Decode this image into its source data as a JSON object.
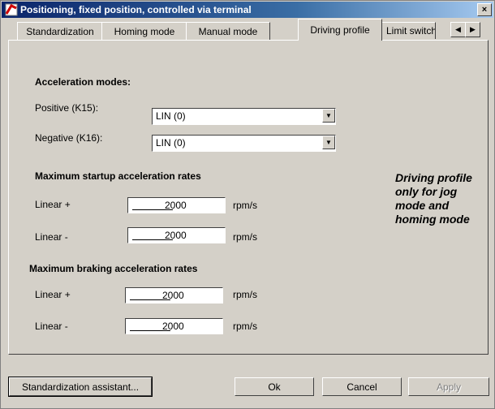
{
  "window": {
    "title": "Positioning, fixed position, controlled via terminal",
    "close": "×"
  },
  "tabs": [
    {
      "label": "Standardization"
    },
    {
      "label": "Homing mode"
    },
    {
      "label": "Manual mode"
    },
    {
      "label": "Driving profile"
    },
    {
      "label": "Limit switch"
    }
  ],
  "tab_scroll": {
    "left": "◀",
    "right": "▶"
  },
  "acceleration_modes": {
    "heading": "Acceleration modes:",
    "positive_label": "Positive (K15):",
    "positive_value": "LIN (0)",
    "negative_label": "Negative (K16):",
    "negative_value": "LIN (0)",
    "dropdown_glyph": "▼"
  },
  "startup": {
    "heading": "Maximum startup acceleration rates",
    "linear_plus_label": "Linear +",
    "linear_plus_value": "2000",
    "linear_minus_label": "Linear -",
    "linear_minus_value": "2000",
    "unit": "rpm/s"
  },
  "braking": {
    "heading": "Maximum braking acceleration rates",
    "linear_plus_label": "Linear +",
    "linear_plus_value": "2000",
    "linear_minus_label": "Linear -",
    "linear_minus_value": "2000",
    "unit": "rpm/s"
  },
  "note": {
    "line1": "Driving profile",
    "line2": "only for jog",
    "line3": "mode and",
    "line4": "homing mode"
  },
  "buttons": {
    "assistant": "Standardization assistant...",
    "ok": "Ok",
    "cancel": "Cancel",
    "apply": "Apply"
  }
}
